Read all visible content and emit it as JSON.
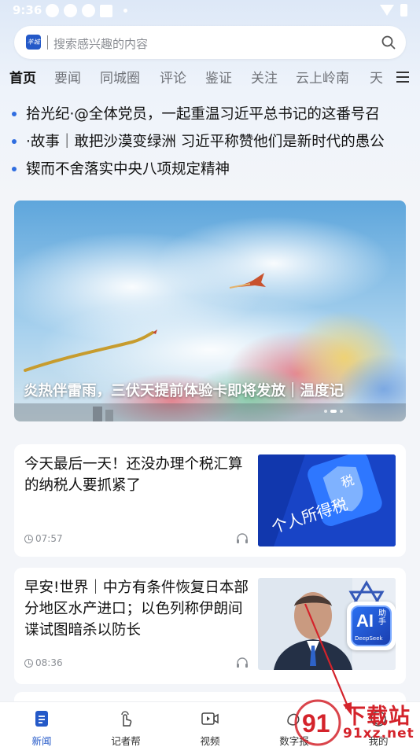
{
  "status_bar": {
    "time": "9:36"
  },
  "search": {
    "placeholder": "搜索感兴趣的内容",
    "logo_text": "羊城"
  },
  "tabs": [
    {
      "label": "首页",
      "active": true
    },
    {
      "label": "要闻"
    },
    {
      "label": "同城圈"
    },
    {
      "label": "评论"
    },
    {
      "label": "鉴证"
    },
    {
      "label": "关注"
    },
    {
      "label": "云上岭南"
    },
    {
      "label": "天"
    }
  ],
  "headlines": [
    "拾光纪·@全体党员，一起重温习近平总书记的这番号召",
    "·故事｜敢把沙漠变绿洲 习近平称赞他们是新时代的愚公",
    "锲而不舍落实中央八项规定精神"
  ],
  "banner": {
    "title": "炎热伴雷雨，三伏天提前体验卡即将发放｜温度记"
  },
  "articles": [
    {
      "title": "今天最后一天！还没办理个税汇算的纳税人要抓紧了",
      "time": "07:57",
      "thumb_text": "个人所得税",
      "thumb_badge": "税"
    },
    {
      "title": "早安!世界｜中方有条件恢复日本部分地区水产进口；以色列称伊朗间谍试图暗杀以防长",
      "time": "08:36",
      "ai_badge": {
        "ai": "AI",
        "helper": "助手",
        "brand": "DeepSeek"
      }
    }
  ],
  "bottom_nav": [
    {
      "label": "新闻",
      "icon": "news-icon",
      "active": true
    },
    {
      "label": "记者帮",
      "icon": "hand-icon"
    },
    {
      "label": "视频",
      "icon": "video-icon"
    },
    {
      "label": "数字报",
      "icon": "digital-paper-icon"
    },
    {
      "label": "我的",
      "icon": "profile-icon"
    }
  ],
  "watermark": {
    "text": "下载站",
    "url": "91xz.net",
    "logo_digits": "91"
  },
  "colors": {
    "accent": "#2459c8",
    "dot": "#2f6de0",
    "annotation": "#d4232b"
  }
}
